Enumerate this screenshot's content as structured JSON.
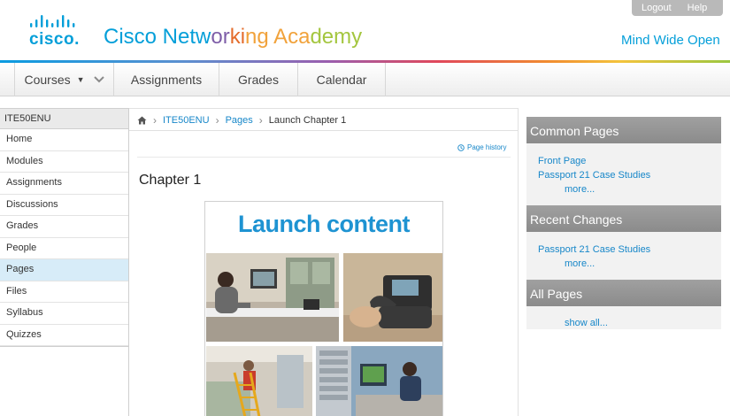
{
  "topbar": {
    "logout": "Logout",
    "help": "Help"
  },
  "brand": {
    "logo_text": "cisco.",
    "name_parts": [
      "Cisco Netw",
      "or",
      "ki",
      "ng Aca",
      "demy"
    ],
    "tagline": "Mind Wide Open"
  },
  "nav": {
    "courses": "Courses",
    "assignments": "Assignments",
    "grades": "Grades",
    "calendar": "Calendar"
  },
  "sidebar": {
    "course_code": "ITE50ENU",
    "items": [
      {
        "label": "Home"
      },
      {
        "label": "Modules"
      },
      {
        "label": "Assignments"
      },
      {
        "label": "Discussions"
      },
      {
        "label": "Grades"
      },
      {
        "label": "People"
      },
      {
        "label": "Pages"
      },
      {
        "label": "Files"
      },
      {
        "label": "Syllabus"
      },
      {
        "label": "Quizzes"
      }
    ],
    "active": "Pages"
  },
  "breadcrumb": {
    "course": "ITE50ENU",
    "section": "Pages",
    "current": "Launch Chapter 1"
  },
  "main": {
    "history": "Page history",
    "title": "Chapter 1",
    "poster_title": "Launch content"
  },
  "right": {
    "common": {
      "title": "Common Pages",
      "links": [
        "Front Page",
        "Passport 21 Case Studies"
      ],
      "more": "more..."
    },
    "recent": {
      "title": "Recent Changes",
      "links": [
        "Passport 21 Case Studies"
      ],
      "more": "more..."
    },
    "all": {
      "title": "All Pages",
      "show_all": "show all..."
    }
  },
  "colors": {
    "cisco_blue": "#049fd9",
    "link": "#1787c9",
    "active_item": "#d7ecf8",
    "panel_header": "#999999"
  }
}
